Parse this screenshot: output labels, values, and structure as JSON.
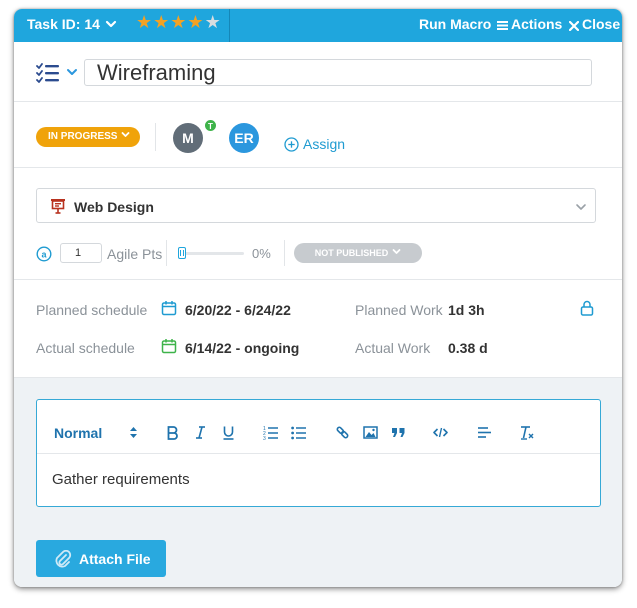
{
  "header": {
    "task_id": "Task ID: 14",
    "rating": 4,
    "rating_max": 5,
    "run_macro": "Run Macro",
    "actions": "Actions",
    "close": "Close",
    "accent_color": "#1fa6dd",
    "star_color": "#f3a224"
  },
  "title": {
    "value": "Wireframing"
  },
  "status": {
    "label": "IN PROGRESS",
    "color": "#f0a30a"
  },
  "assignees": [
    {
      "initials": "M",
      "badge": "T",
      "color": "#616d78"
    },
    {
      "initials": "ER",
      "color": "#2b97de"
    }
  ],
  "assign_label": "Assign",
  "project": {
    "name": "Web Design"
  },
  "agile": {
    "points": "1",
    "label": "Agile Pts",
    "progress_percent": 0,
    "progress_label": "0%",
    "publish_status": "NOT PUBLISHED"
  },
  "schedule": {
    "planned_label": "Planned schedule",
    "planned_value": "6/20/22 - 6/24/22",
    "actual_label": "Actual schedule",
    "actual_value": "6/14/22 - ongoing",
    "planned_work_label": "Planned Work",
    "planned_work_value": "1d 3h",
    "actual_work_label": "Actual Work",
    "actual_work_value": "0.38 d"
  },
  "editor": {
    "format": "Normal",
    "content": "Gather requirements"
  },
  "attach_label": "Attach File"
}
